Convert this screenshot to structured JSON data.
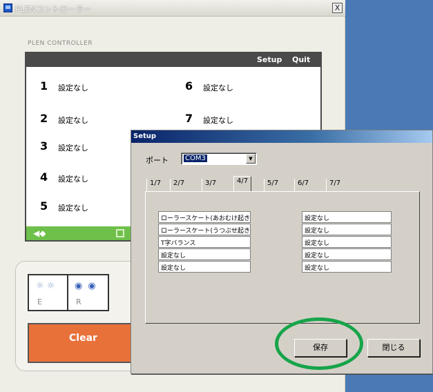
{
  "window": {
    "title": "PLENコントローラー",
    "close_label": "X",
    "subtitle": "PLEN CONTROLLER"
  },
  "panel": {
    "setup_label": "Setup",
    "quit_label": "Quit",
    "slots": [
      {
        "num": "1",
        "label": "設定なし"
      },
      {
        "num": "2",
        "label": "設定なし"
      },
      {
        "num": "3",
        "label": "設定なし"
      },
      {
        "num": "4",
        "label": "設定なし"
      },
      {
        "num": "5",
        "label": "設定なし"
      },
      {
        "num": "6",
        "label": "設定なし"
      },
      {
        "num": "7",
        "label": "設定なし"
      }
    ]
  },
  "toggles": {
    "left_icons": "☼☼",
    "right_icons": "◉◉",
    "e_label": "E",
    "r_label": "R"
  },
  "clear": {
    "label": "Clear"
  },
  "dialog": {
    "title": "Setup",
    "port_label": "ポート",
    "port_value": "COM3",
    "tabs": [
      "1/7",
      "2/7",
      "3/7",
      "4/7",
      "5/7",
      "6/7",
      "7/7"
    ],
    "active_tab": "4/7",
    "left_fields": [
      "ローラースケート(あおむけ起き",
      "ローラースケート(うつぶせ起き",
      "T字バランス",
      "設定なし",
      "設定なし"
    ],
    "right_fields": [
      "設定なし",
      "設定なし",
      "設定なし",
      "設定なし",
      "設定なし"
    ],
    "save_label": "保存",
    "close_label": "閉じる"
  },
  "colors": {
    "desktop": "#4a79b5",
    "panel_header": "#4a4a4a",
    "panel_footer": "#6fc04a",
    "clear_button": "#e8713a",
    "highlight_ring": "#17a44a"
  }
}
